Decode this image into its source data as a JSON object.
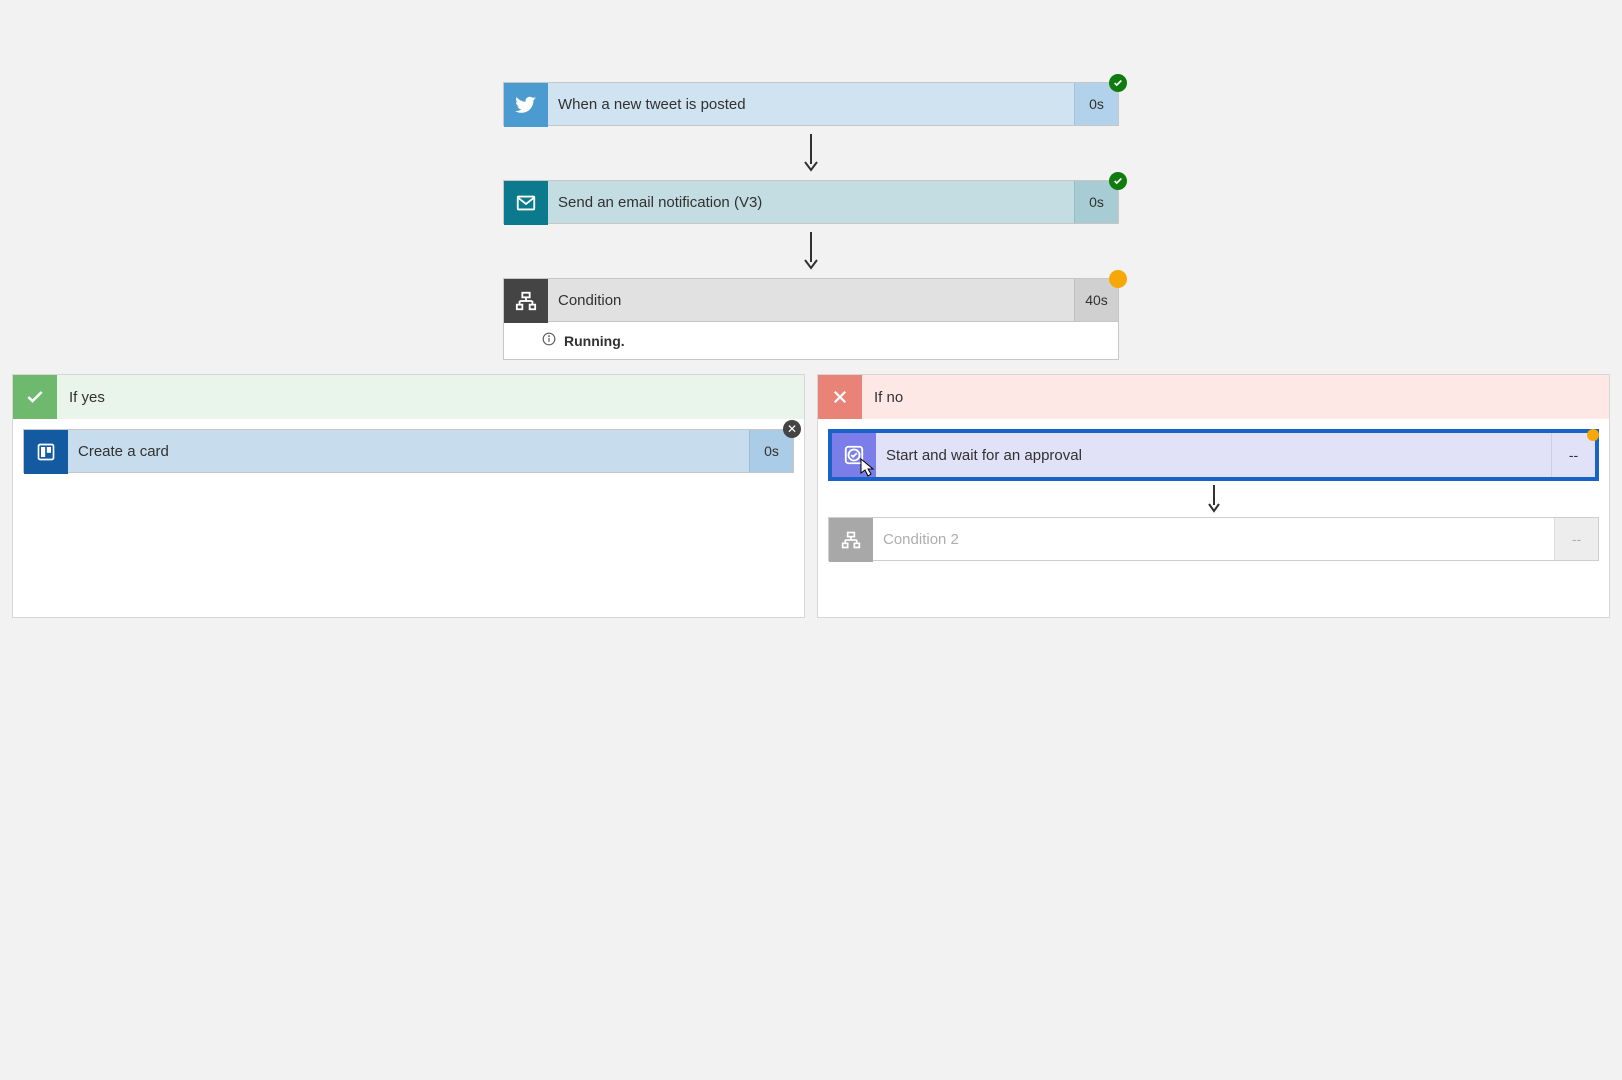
{
  "steps": {
    "twitter": {
      "label": "When a new tweet is posted",
      "duration": "0s",
      "status": "success"
    },
    "email": {
      "label": "Send an email notification (V3)",
      "duration": "0s",
      "status": "success"
    },
    "condition": {
      "label": "Condition",
      "duration": "40s",
      "status": "running",
      "status_text": "Running."
    }
  },
  "branches": {
    "yes": {
      "label": "If yes",
      "trello": {
        "label": "Create a card",
        "duration": "0s"
      }
    },
    "no": {
      "label": "If no",
      "approval": {
        "label": "Start and wait for an approval",
        "duration": "--"
      },
      "condition2": {
        "label": "Condition 2",
        "duration": "--"
      }
    }
  }
}
